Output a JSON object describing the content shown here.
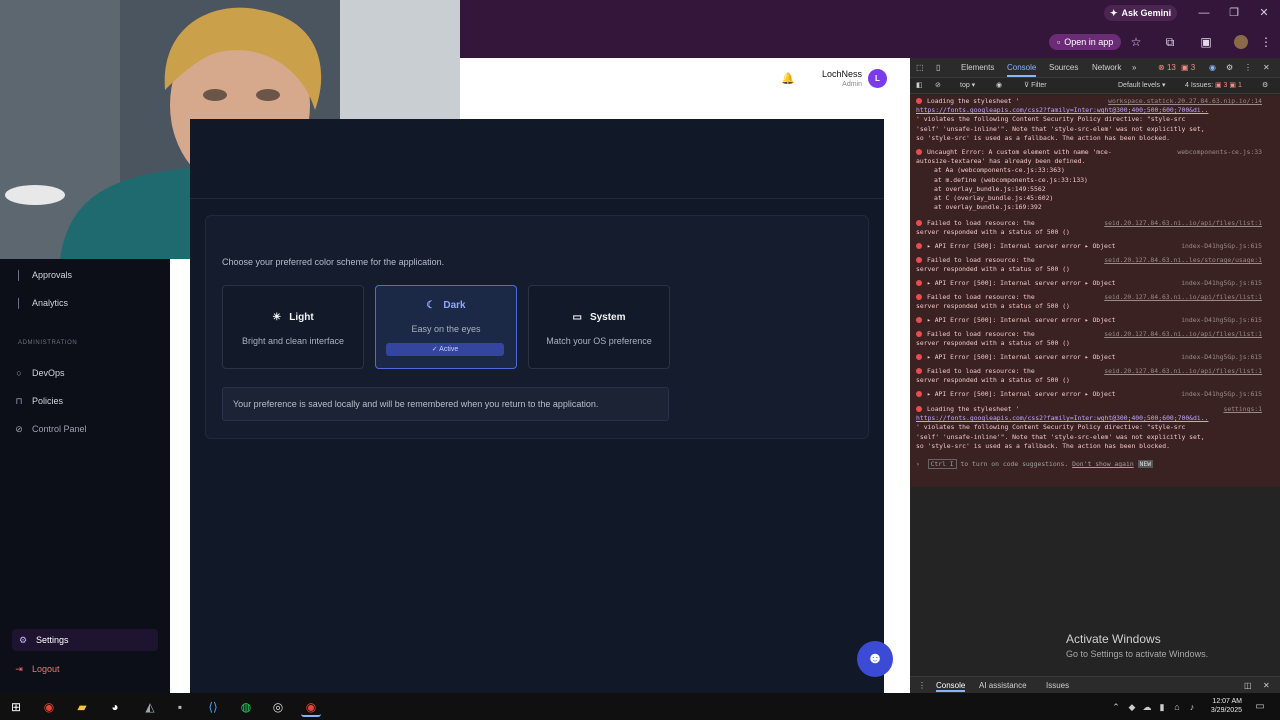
{
  "browser": {
    "gemini_label": "Ask Gemini",
    "open_app_label": "Open in app"
  },
  "header": {
    "user_name": "LochNess",
    "user_role": "Admin",
    "avatar_initial": "L"
  },
  "sidebar": {
    "items": [
      {
        "label": "Approvals",
        "icon": "check-circle-icon"
      },
      {
        "label": "Analytics",
        "icon": "bar-chart-icon"
      }
    ],
    "admin_section_label": "ADMINISTRATION",
    "admin_items": [
      {
        "label": "DevOps",
        "icon": "circle-icon"
      },
      {
        "label": "Policies",
        "icon": "lock-icon"
      },
      {
        "label": "Control Panel",
        "icon": "sliders-icon"
      }
    ],
    "settings_label": "Settings",
    "logout_label": "Logout"
  },
  "theme": {
    "description": "Choose your preferred color scheme for the application.",
    "options": [
      {
        "title": "Light",
        "subtitle": "Bright and clean interface",
        "icon": "sun-icon"
      },
      {
        "title": "Dark",
        "subtitle": "Easy on the eyes",
        "icon": "moon-icon",
        "active_label": "✓ Active"
      },
      {
        "title": "System",
        "subtitle": "Match your OS preference",
        "icon": "monitor-icon"
      }
    ],
    "note": "Your preference is saved locally and will be remembered when you return to the application."
  },
  "devtools": {
    "tabs": [
      "Elements",
      "Console",
      "Sources",
      "Network"
    ],
    "error_count": "13",
    "warning_count": "3",
    "context": "top",
    "filter_placeholder": "Filter",
    "levels": "Default levels",
    "issues": "4 Issues: ",
    "issues_errors": "3",
    "issues_warnings": "1",
    "logs": [
      {
        "text": "Loading the stylesheet '",
        "link": "workspace.statick.20.27.84.63.nip.io/:14",
        "line2": "https://fonts.googleapis.com/css2?family=Inter:wght@300;400;500;600;700&di..",
        "line3": "' violates the following Content Security Policy directive: \"style-src",
        "line4": "'self' 'unsafe-inline'\". Note that 'style-src-elem' was not explicitly set,",
        "line5": "so 'style-src' is used as a fallback. The action has been blocked."
      },
      {
        "text": "Uncaught Error: A custom element with name 'mce-",
        "src": "webcomponents-ce.js:33",
        "line2": "autosize-textarea' has already been defined.",
        "line3": "at Aa (webcomponents-ce.js:33:363)",
        "line4": "at m.define (webcomponents-ce.js:33:133)",
        "line5": "at overlay_bundle.js:149:5562",
        "line6": "at C (overlay_bundle.js:45:602)",
        "line7": "at overlay_bundle.js:169:392"
      },
      {
        "text": "Failed to load resource: the",
        "link": "seid.20.127.84.63.ni..io/api/files/list:1",
        "line2": "server responded with a status of 500 ()"
      },
      {
        "text": "▸ API Error [500]: Internal server error ▸ Object",
        "src": "index-D41hg5Gp.js:615"
      },
      {
        "text": "Failed to load resource: the",
        "link": "seid.20.127.84.63.ni..les/storage/usage:1",
        "line2": "server responded with a status of 500 ()"
      },
      {
        "text": "▸ API Error [500]: Internal server error ▸ Object",
        "src": "index-D41hg5Gp.js:615"
      },
      {
        "text": "Failed to load resource: the",
        "link": "seid.20.127.84.63.ni..io/api/files/list:1",
        "line2": "server responded with a status of 500 ()"
      },
      {
        "text": "▸ API Error [500]: Internal server error ▸ Object",
        "src": "index-D41hg5Gp.js:615"
      },
      {
        "text": "Failed to load resource: the",
        "link": "seid.20.127.84.63.ni..io/api/files/list:1",
        "line2": "server responded with a status of 500 ()"
      },
      {
        "text": "▸ API Error [500]: Internal server error ▸ Object",
        "src": "index-D41hg5Gp.js:615"
      },
      {
        "text": "Failed to load resource: the",
        "link": "seid.20.127.84.63.ni..io/api/files/list:1",
        "line2": "server responded with a status of 500 ()"
      },
      {
        "text": "▸ API Error [500]: Internal server error ▸ Object",
        "src": "index-D41hg5Gp.js:615"
      },
      {
        "text": "Loading the stylesheet '",
        "link": "settings:1",
        "line2": "https://fonts.googleapis.com/css2?family=Inter:wght@300;400;500;600;700&di..",
        "line3": "' violates the following Content Security Policy directive: \"style-src",
        "line4": "'self' 'unsafe-inline'\". Note that 'style-src-elem' was not explicitly set,",
        "line5": "so 'style-src' is used as a fallback. The action has been blocked."
      }
    ],
    "prompt_hint": "to turn on code suggestions.",
    "prompt_keys": "Ctrl I",
    "prompt_dismiss": "Don't show again",
    "prompt_new": "NEW",
    "bottom_tabs": [
      "Console",
      "AI assistance",
      "Issues"
    ]
  },
  "activation": {
    "title": "Activate Windows",
    "subtitle": "Go to Settings to activate Windows."
  },
  "taskbar": {
    "time": "12:07 AM",
    "date": "3/29/2025"
  }
}
